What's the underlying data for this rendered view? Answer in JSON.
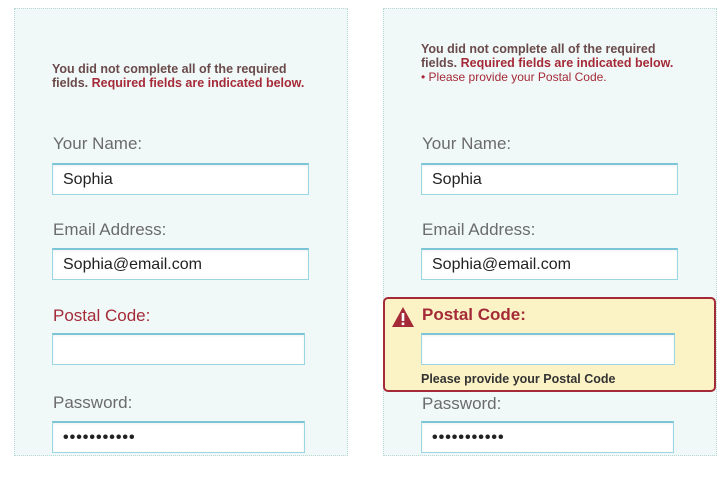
{
  "left_form": {
    "error_text": "You did not complete all of the required fields.",
    "error_required": "Required fields are indicated below.",
    "name_label": "Your Name:",
    "name_value": "Sophia",
    "email_label": "Email Address:",
    "email_value": "Sophia@email.com",
    "postal_label": "Postal Code:",
    "postal_value": "",
    "password_label": "Password:",
    "password_value": "•••••••••••"
  },
  "right_form": {
    "error_text": "You did not complete all of the required fields.",
    "error_required": "Required fields are indicated below.",
    "error_bullet": "• Please provide your Postal Code.",
    "name_label": "Your Name:",
    "name_value": "Sophia",
    "email_label": "Email Address:",
    "email_value": "Sophia@email.com",
    "postal_label": "Postal Code:",
    "postal_value": "",
    "postal_hint": "Please provide your Postal Code",
    "password_label": "Password:",
    "password_value": "•••••••••••",
    "warning_icon": "warning-triangle-icon"
  },
  "colors": {
    "error_red": "#a52a38",
    "panel_bg": "#f0f9f8",
    "error_box_bg": "#fbf3c6",
    "input_border": "#9ad7e4"
  }
}
